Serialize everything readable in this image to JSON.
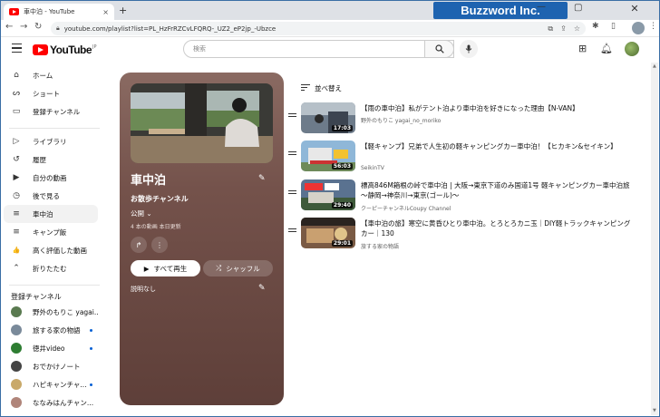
{
  "browser": {
    "tab_title": "車中泊 - YouTube",
    "new_tab": "+",
    "tab_close": "×",
    "url": "youtube.com/playlist?list=PL_HzFrRZCvLFQRQ-_UZ2_eP2jp_-Ubzce",
    "window_minimize": "—",
    "window_maximize": "▢",
    "window_close": "✕",
    "brand_text": "Buzzword Inc."
  },
  "header": {
    "logo_text": "YouTube",
    "logo_region": "JP",
    "search_placeholder": "検索"
  },
  "sidebar": {
    "items": [
      {
        "label": "ホーム",
        "icon": "home-icon",
        "glyph": "⌂"
      },
      {
        "label": "ショート",
        "icon": "shorts-icon",
        "glyph": "ᔕ"
      },
      {
        "label": "登録チャンネル",
        "icon": "subscriptions-icon",
        "glyph": "▭"
      },
      {
        "label": "ライブラリ",
        "icon": "library-icon",
        "glyph": "▷"
      },
      {
        "label": "履歴",
        "icon": "history-icon",
        "glyph": "↺"
      },
      {
        "label": "自分の動画",
        "icon": "your-videos-icon",
        "glyph": "▶"
      },
      {
        "label": "後で見る",
        "icon": "watch-later-icon",
        "glyph": "◷"
      },
      {
        "label": "車中泊",
        "icon": "playlist-icon",
        "glyph": "≡"
      },
      {
        "label": "キャンプ飯",
        "icon": "playlist-icon",
        "glyph": "≡"
      },
      {
        "label": "高く評価した動画",
        "icon": "like-icon",
        "glyph": "👍"
      },
      {
        "label": "折りたたむ",
        "icon": "chevron-up-icon",
        "glyph": "⌃"
      }
    ],
    "subs_heading": "登録チャンネル",
    "subscriptions": [
      {
        "name": "野外のもりこ yagai...",
        "color": "#5a7a50",
        "live": false
      },
      {
        "name": "旅する家の物語",
        "color": "#7a8a9a",
        "live": true
      },
      {
        "name": "徳井video",
        "color": "#2e7d32",
        "live": true
      },
      {
        "name": "おでかけノート",
        "color": "#444444",
        "live": false
      },
      {
        "name": "ハピキャンチャ...",
        "color": "#c9a96a",
        "live": true
      },
      {
        "name": "ななみはんチャン...",
        "color": "#b0857a",
        "live": false
      }
    ]
  },
  "playlist": {
    "title": "車中泊",
    "owner": "お散歩チャンネル",
    "privacy": "公開",
    "stats": "4 本の動画  本日更新",
    "play_all": "すべて再生",
    "shuffle": "シャッフル",
    "description": "説明なし"
  },
  "videos": {
    "sort_label": "並べ替え",
    "items": [
      {
        "title": "【雨の車中泊】私がテント泊より車中泊を好きになった理由【N-VAN】",
        "channel": "野外のもりこ yagai_no_moriko",
        "duration": "17:03"
      },
      {
        "title": "【軽キャンプ】兄弟で人生初の軽キャンピングカー車中泊！【ヒカキン&セイキン】",
        "channel": "SeikinTV",
        "duration": "56:03"
      },
      {
        "title": "標高846M箱根の峠で車中泊 | 大阪→東京下道のみ国道1号 軽キャンピングカー車中泊旅 ～静岡→神奈川→東京(ゴール)～",
        "channel": "クーピーチャンネルCoupy Channel",
        "duration": "29:40"
      },
      {
        "title": "【車中泊の旅】寒空に黄昏ひとり車中泊。とろとろカニ玉｜DIY軽トラックキャンピングカー｜130",
        "channel": "旅する家の物語",
        "duration": "29:01"
      }
    ]
  },
  "colors": {
    "accent": "#ff0000",
    "panel_top": "#8a6a62",
    "panel_bottom": "#5e3f39",
    "brand": "#1e63b0"
  }
}
